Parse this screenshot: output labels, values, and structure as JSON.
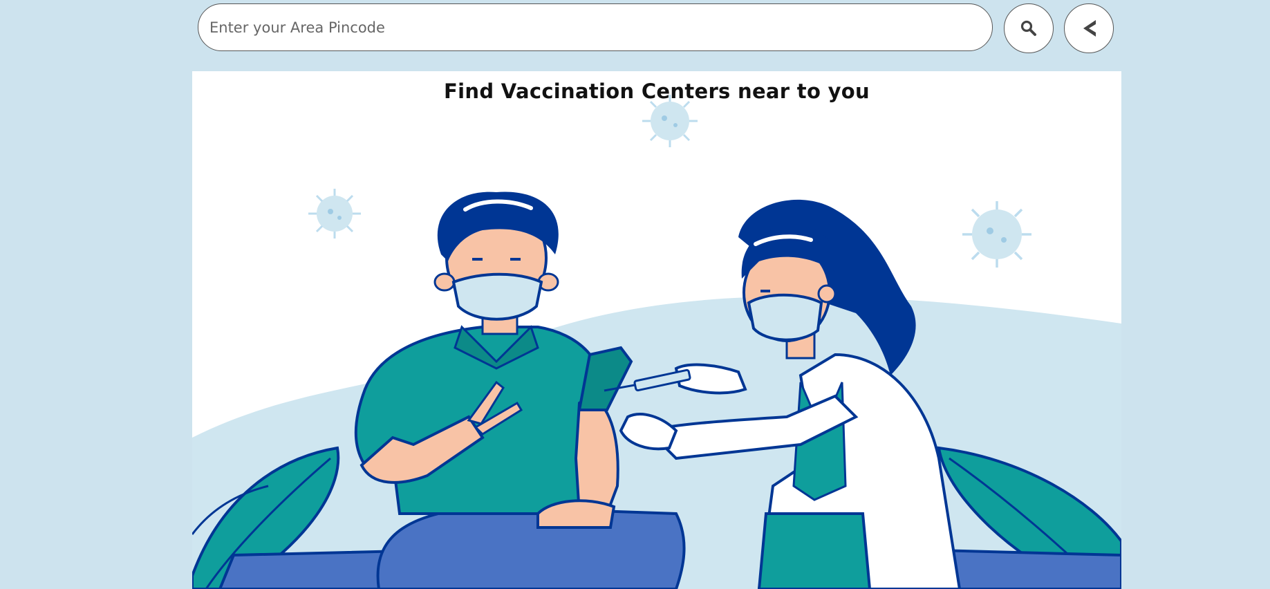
{
  "search": {
    "placeholder": "Enter your Area Pincode",
    "search_icon": "magnifier-icon",
    "back_icon": "chevron-left-icon"
  },
  "main": {
    "title": "Find Vaccination Centers near to you"
  },
  "colors": {
    "page_background": "#cde3ee",
    "card_background": "#ffffff",
    "teal": "#0f9e9c",
    "navy": "#003694",
    "mask_blue": "#cfe6f0",
    "pants_blue": "#4a73c4"
  }
}
